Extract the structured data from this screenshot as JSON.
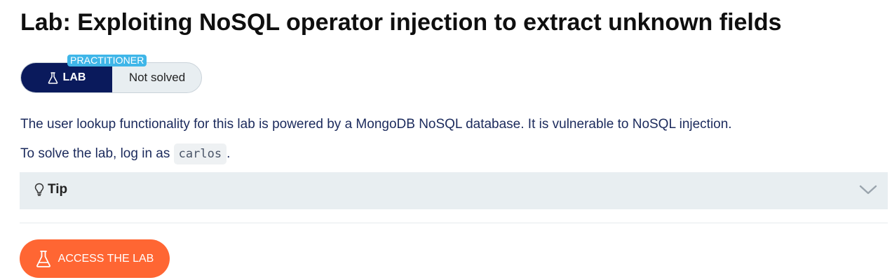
{
  "lab": {
    "title": "Lab: Exploiting NoSQL operator injection to extract unknown fields",
    "level": "PRACTITIONER",
    "badge_label": "LAB",
    "status": "Not solved",
    "description_1": "The user lookup functionality for this lab is powered by a MongoDB NoSQL database. It is vulnerable to NoSQL injection.",
    "description_2_prefix": "To solve the lab, log in as ",
    "description_2_code": "carlos",
    "description_2_suffix": "."
  },
  "tip": {
    "label": "Tip",
    "icon": "lightbulb-icon",
    "toggle_icon": "chevron-down-icon"
  },
  "actions": {
    "access_label": "ACCESS THE LAB",
    "access_icon": "flask-icon"
  },
  "colors": {
    "badge_level": "#3fb6e8",
    "lab_pill": "#0a1a5c",
    "status_bg": "#e8eef1",
    "access_button": "#ff6633",
    "text_body": "#1b2a5c"
  }
}
